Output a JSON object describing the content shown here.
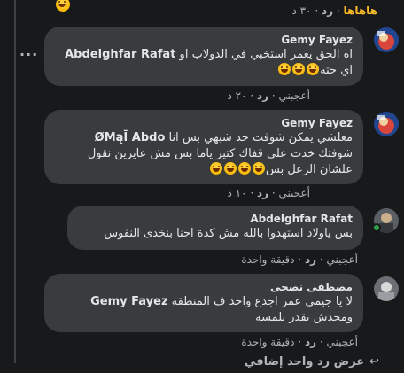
{
  "top_actions": {
    "haha": "هاهاها",
    "reply": "رد",
    "time": "٣٠ د"
  },
  "comments": [
    {
      "author": "Gemy Fayez",
      "line1_plain": "اه الحق يعمر استخبي في الدولاب او ",
      "line1_mention": "Abdelghfar Rafat",
      "line2": "اي حته",
      "like": "أعجبني",
      "reply": "رد",
      "time": "٢٠ د"
    },
    {
      "author": "Gemy Fayez",
      "line1_plain": "معلشي يمكن شوفت حد شبهي بس انا ",
      "line1_mention": "ØMąĪ Abdo",
      "line2": "شوفتك خدت علي قفاك كتير ياما بس مش عايزين نقول",
      "line3": "علشان الزعل بس",
      "like": "أعجبني",
      "reply": "رد",
      "time": "١٠ د"
    },
    {
      "author": "Abdelghfar Rafat",
      "line1": "بس ياولاد استهدوا بالله مش كدة احنا بنخدى النفوس",
      "like": "أعجبني",
      "reply": "رد",
      "time": "دقيقة واحدة"
    },
    {
      "author": "مصطفى نصحى",
      "line1_plain": "لا يا جيمي عمر اجدع واحد ف المنطقه ",
      "line1_mention": "Gemy Fayez",
      "line2": "ومحدش يقدر يلمسه",
      "like": "أعجبني",
      "reply": "رد",
      "time": "دقيقة واحدة"
    }
  ],
  "view_more": "عرض رد واحد إضافي",
  "more_options": "···",
  "colors": {
    "background": "#18191a",
    "bubble": "#3a3b3c",
    "haha": "#f7b928"
  }
}
